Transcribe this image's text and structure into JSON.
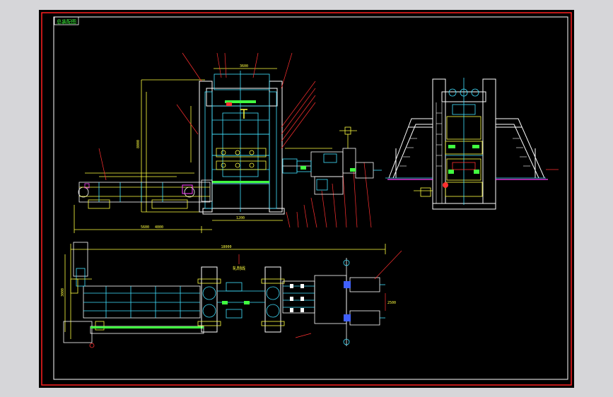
{
  "window": {
    "bg_color": "#d6d6d9"
  },
  "canvas": {
    "bg_color": "#000000"
  },
  "sheet": {
    "title_block_text": "总装配图",
    "frame_color": "#ff2020"
  },
  "colors": {
    "yellow": "#ffff40",
    "cyan": "#40e0ff",
    "white": "#ffffff",
    "red": "#ff3030",
    "green": "#40ff40",
    "magenta": "#ff40ff",
    "blue": "#4060ff"
  },
  "annotations": {
    "front_top_dim": "3600",
    "front_height_dim": "8000",
    "front_left_dim": "5600",
    "front_bottom_dim": "1200",
    "front_mid_dim": "4000",
    "plan_width_dim": "18000",
    "plan_height_dim": "3000",
    "plan_center_note": "轧制线",
    "plan_right_dim": "2500"
  }
}
